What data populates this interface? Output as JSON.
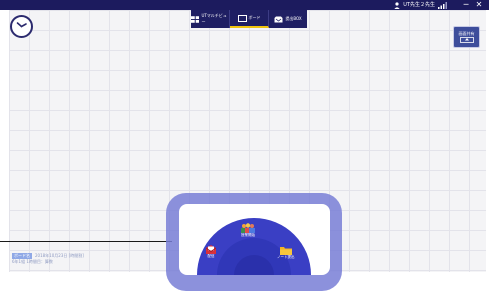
{
  "titlebar": {
    "user_name": "UT先生２先生",
    "minimize": "─",
    "close": "✕"
  },
  "tabs": [
    {
      "label": "UTマルチビュー",
      "icon": "grid-icon",
      "active": false
    },
    {
      "label": "ボード",
      "icon": "board-icon",
      "active": true
    },
    {
      "label": "提出BOX",
      "icon": "inbox-icon",
      "active": false
    }
  ],
  "right_button": {
    "label": "画面共有"
  },
  "menu": {
    "items": [
      {
        "label": "授業開始",
        "icon": "class-start-icon"
      },
      {
        "label": "配信",
        "icon": "distribute-icon"
      },
      {
        "label": "ノート提出",
        "icon": "folder-icon"
      }
    ]
  },
  "status": {
    "badge": "ボード名",
    "date": "2018年10月23日 [時間割]",
    "period": "6年1組 1時間目：算数"
  },
  "colors": {
    "topbar": "#1c1b5e",
    "menu_blue": "#3a3fc4",
    "accent_yellow": "#f1c50e"
  }
}
